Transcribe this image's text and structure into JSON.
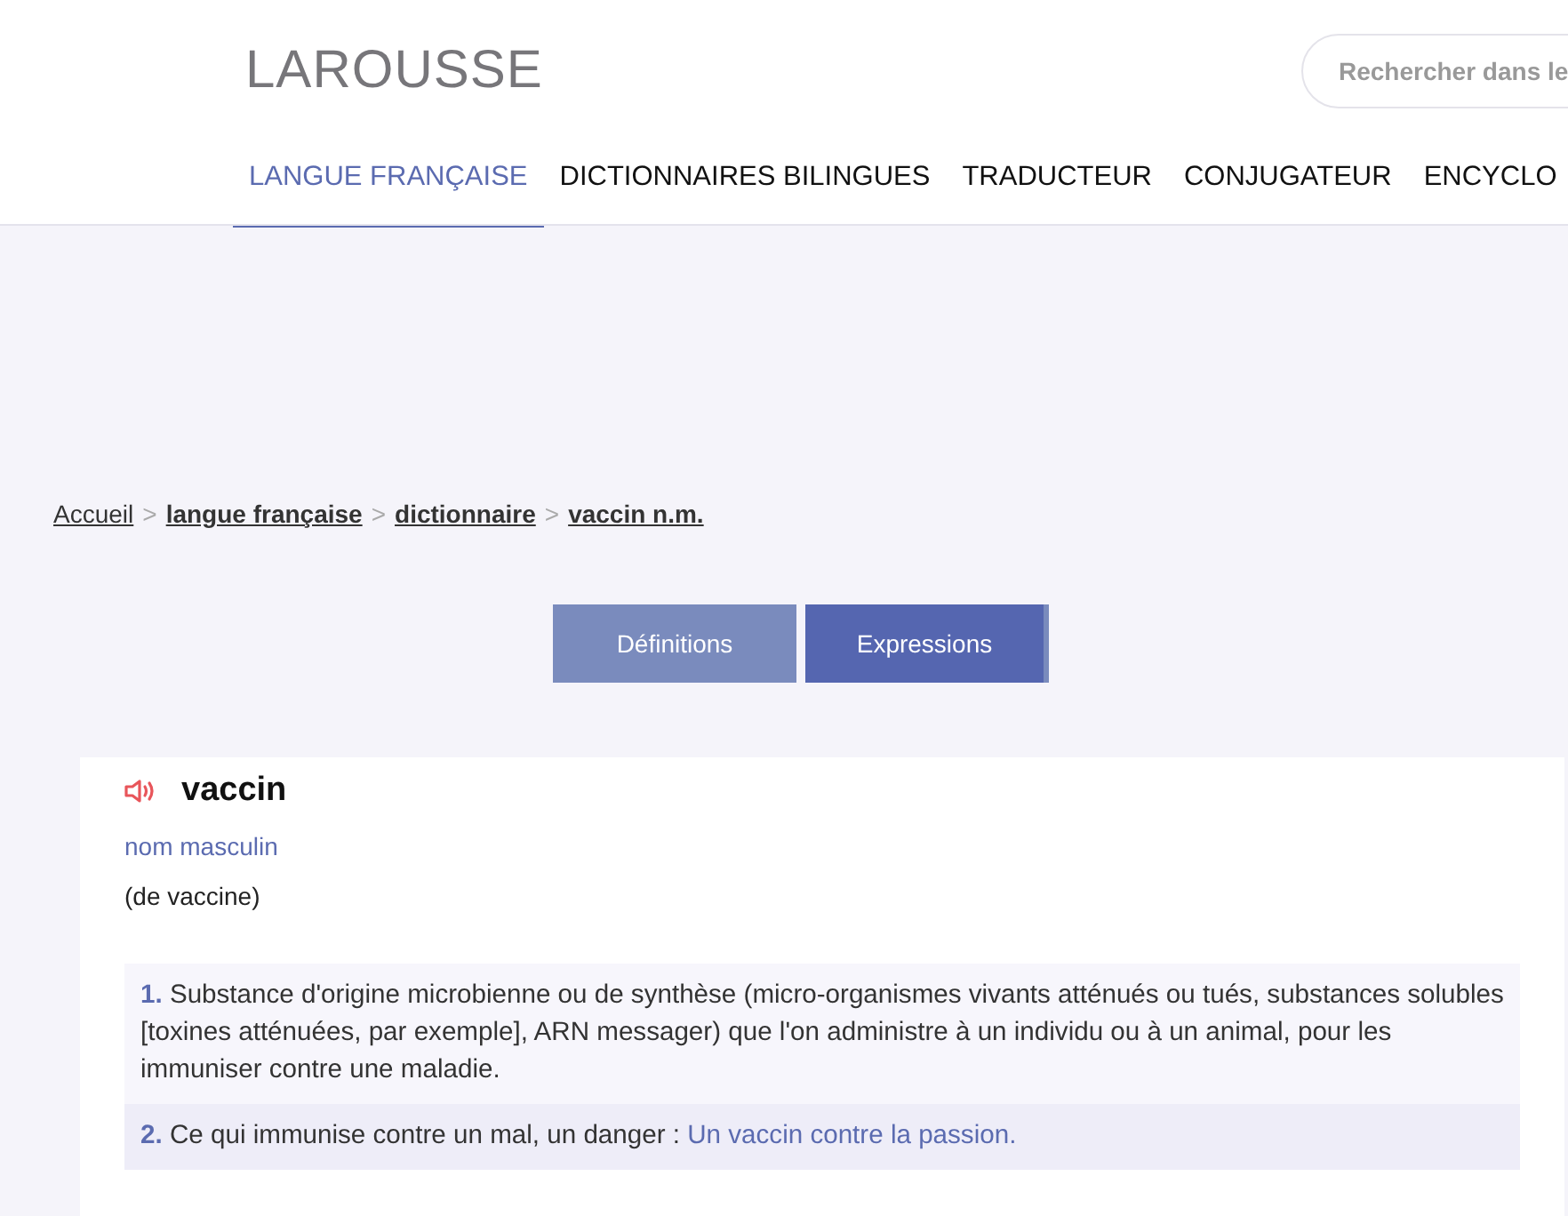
{
  "header": {
    "logo": "LAROUSSE",
    "search": {
      "placeholder": "Rechercher dans le"
    }
  },
  "nav": [
    {
      "label": "LANGUE FRANÇAISE",
      "selected": true
    },
    {
      "label": "DICTIONNAIRES BILINGUES",
      "selected": false
    },
    {
      "label": "TRADUCTEUR",
      "selected": false
    },
    {
      "label": "CONJUGATEUR",
      "selected": false
    },
    {
      "label": "ENCYCLO",
      "selected": false
    }
  ],
  "breadcrumb": {
    "separator": ">",
    "items": [
      {
        "label": "Accueil",
        "bold": false
      },
      {
        "label": "langue française",
        "bold": true
      },
      {
        "label": "dictionnaire",
        "bold": true
      },
      {
        "label": "vaccin n.m.",
        "bold": true
      }
    ]
  },
  "tabs": [
    {
      "label": "Définitions",
      "selected": false
    },
    {
      "label": "Expressions",
      "selected": true
    }
  ],
  "entry": {
    "word": "vaccin",
    "category": "nom masculin",
    "etymology": "(de vaccine)",
    "definitions": [
      {
        "number": "1.",
        "text": "Substance d'origine microbienne ou de synthèse (micro-organismes vivants atténués ou tués, substances solubles [toxines atténuées, par exemple], ARN messager) que l'on administre à un individu ou à un animal, pour les immuniser contre une maladie."
      },
      {
        "number": "2.",
        "text": "Ce qui immunise contre un mal, un danger :",
        "example": "Un vaccin contre la passion."
      }
    ]
  }
}
